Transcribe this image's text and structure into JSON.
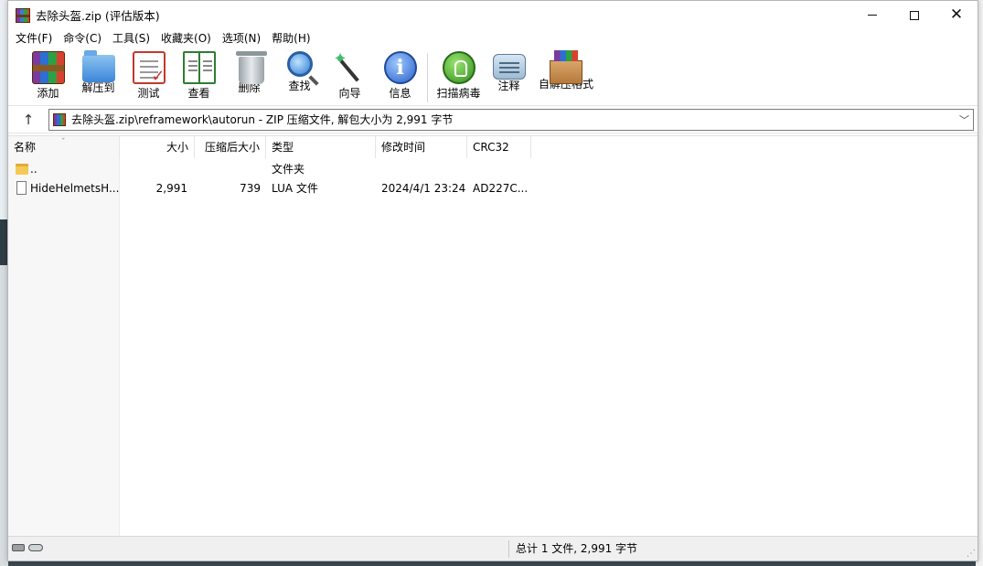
{
  "window": {
    "title": "去除头盔.zip (评估版本)",
    "minimize_label": "",
    "maximize_label": "",
    "close_label": "✕"
  },
  "menu": [
    {
      "label": "文件(F)"
    },
    {
      "label": "命令(C)"
    },
    {
      "label": "工具(S)"
    },
    {
      "label": "收藏夹(O)"
    },
    {
      "label": "选项(N)"
    },
    {
      "label": "帮助(H)"
    }
  ],
  "toolbar": {
    "add": {
      "label": "添加",
      "icon": "archive-add-icon"
    },
    "extract": {
      "label": "解压到",
      "icon": "folder-extract-icon"
    },
    "test": {
      "label": "测试",
      "icon": "clipboard-check-icon"
    },
    "view": {
      "label": "查看",
      "icon": "book-icon"
    },
    "delete": {
      "label": "删除",
      "icon": "trash-icon"
    },
    "find": {
      "label": "查找",
      "icon": "magnifier-icon"
    },
    "wizard": {
      "label": "向导",
      "icon": "magic-wand-icon"
    },
    "info": {
      "label": "信息",
      "icon": "info-icon"
    },
    "scan": {
      "label": "扫描病毒",
      "icon": "virus-scan-icon"
    },
    "comment": {
      "label": "注释",
      "icon": "comment-icon"
    },
    "sfx": {
      "label": "自解压格式",
      "icon": "sfx-box-icon"
    }
  },
  "address": {
    "up_label": "↑",
    "path": "去除头盔.zip\\reframework\\autorun - ZIP 压缩文件, 解包大小为 2,991 字节",
    "dropdown": "﹀"
  },
  "columns": {
    "name": "名称",
    "size": "大小",
    "packed": "压缩后大小",
    "type": "类型",
    "modified": "修改时间",
    "crc": "CRC32",
    "sort_indicator": "ˇ"
  },
  "files": [
    {
      "name": "..",
      "size": "",
      "packed": "",
      "type": "文件夹",
      "modified": "",
      "crc": ""
    },
    {
      "name": "HideHelmetsH...",
      "size": "2,991",
      "packed": "739",
      "type": "LUA 文件",
      "modified": "2024/4/1 23:24",
      "crc": "AD227C..."
    }
  ],
  "status": {
    "summary": "总计 1 文件, 2,991 字节"
  },
  "colors": {
    "nav_pane_bg": "#f7f7f7",
    "status_bg": "#f0f0f0"
  }
}
